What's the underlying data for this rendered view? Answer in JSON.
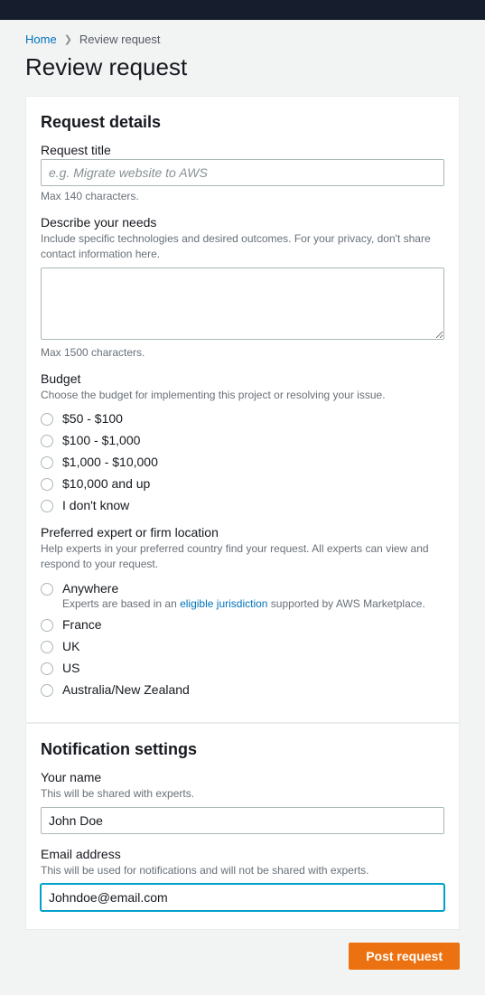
{
  "breadcrumb": {
    "home": "Home",
    "current": "Review request"
  },
  "page_title": "Review request",
  "details": {
    "section_title": "Request details",
    "title_label": "Request title",
    "title_placeholder": "e.g. Migrate website to AWS",
    "title_help": "Max 140 characters.",
    "describe_label": "Describe your needs",
    "describe_desc": "Include specific technologies and desired outcomes. For your privacy, don't share contact information here.",
    "describe_help": "Max 1500 characters.",
    "budget_label": "Budget",
    "budget_desc": "Choose the budget for implementing this project or resolving your issue.",
    "budget_options": [
      "$50 - $100",
      "$100 - $1,000",
      "$1,000 - $10,000",
      "$10,000 and up",
      "I don't know"
    ],
    "location_label": "Preferred expert or firm location",
    "location_desc": "Help experts in your preferred country find your request. All experts can view and respond to your request.",
    "location_anywhere": "Anywhere",
    "location_anywhere_sub_prefix": "Experts are based in an ",
    "location_anywhere_link": "eligible jurisdiction",
    "location_anywhere_sub_suffix": " supported by AWS Marketplace.",
    "location_options": [
      "France",
      "UK",
      "US",
      "Australia/New Zealand"
    ]
  },
  "notifications": {
    "section_title": "Notification settings",
    "name_label": "Your name",
    "name_desc": "This will be shared with experts.",
    "name_value": "John Doe",
    "email_label": "Email address",
    "email_desc": "This will be used for notifications and will not be shared with experts.",
    "email_value": "Johndoe@email.com"
  },
  "actions": {
    "post": "Post request"
  }
}
